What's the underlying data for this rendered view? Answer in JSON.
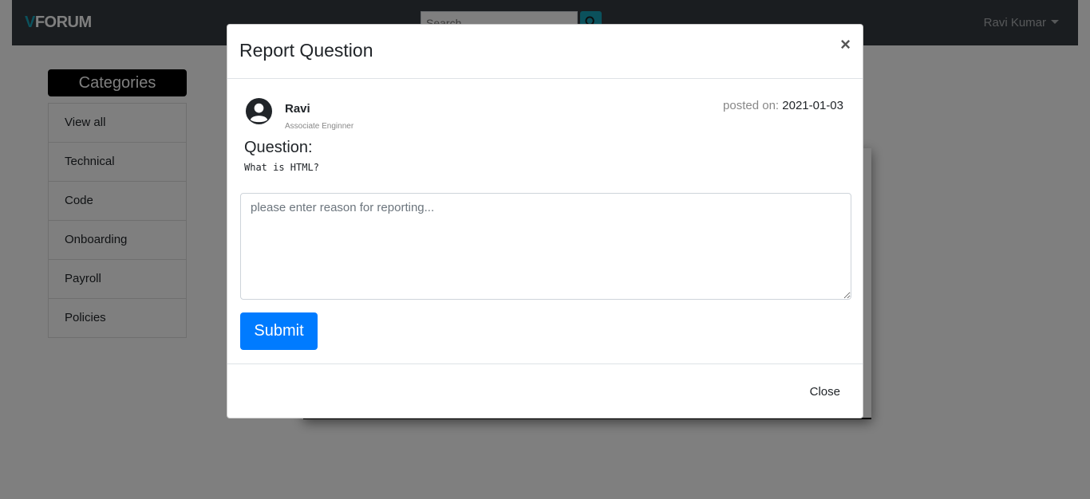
{
  "navbar": {
    "brand_prefix": "V",
    "brand_rest": "FORUM",
    "search_placeholder": "Search",
    "user_name": "Ravi Kumar"
  },
  "sidebar": {
    "title": "Categories",
    "items": [
      {
        "label": "View all"
      },
      {
        "label": "Technical"
      },
      {
        "label": "Code"
      },
      {
        "label": "Onboarding"
      },
      {
        "label": "Payroll"
      },
      {
        "label": "Policies"
      }
    ]
  },
  "modal": {
    "title": "Report Question",
    "close_x": "×",
    "author": {
      "name": "Ravi",
      "role": "Associate Enginner"
    },
    "posted_label": "posted on:",
    "posted_date": "2021-01-03",
    "question_label": "Question:",
    "question_text": "What is HTML?",
    "reason_placeholder": "please enter reason for reporting...",
    "submit_label": "Submit",
    "close_label": "Close"
  },
  "colors": {
    "navbar_bg": "#343a40",
    "brand_accent": "#17a2b8",
    "primary": "#007bff",
    "backdrop": "rgba(0,0,0,0.5)"
  },
  "icons": {
    "search": "search-icon",
    "avatar": "user-circle-icon",
    "caret": "caret-down-icon"
  }
}
